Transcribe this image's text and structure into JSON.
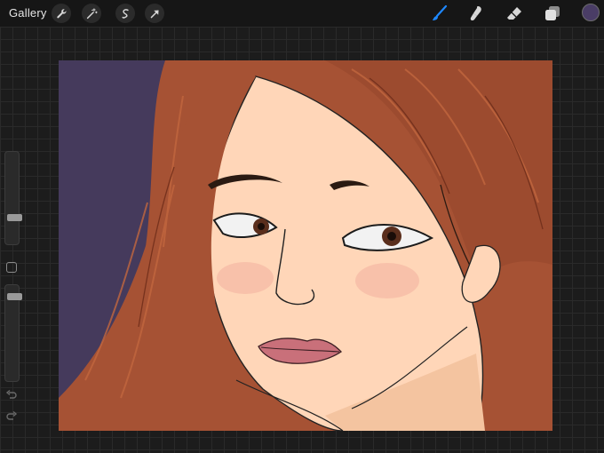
{
  "app": {
    "gallery_label": "Gallery"
  },
  "toolbar_left": [
    {
      "name": "wrench-icon"
    },
    {
      "name": "magic-wand-icon"
    },
    {
      "name": "selection-icon"
    },
    {
      "name": "transform-arrow-icon"
    }
  ],
  "toolbar_right": [
    {
      "name": "brush-icon",
      "active": true
    },
    {
      "name": "smudge-icon",
      "active": false
    },
    {
      "name": "eraser-icon",
      "active": false
    },
    {
      "name": "layers-icon",
      "active": false
    }
  ],
  "colors": {
    "active_tool": "#1e88ff",
    "icon": "#d8d8d8",
    "current_color": "#4a3d66",
    "canvas_background": "#453a5c",
    "hair": "#a65234",
    "skin": "#ffd6b8"
  },
  "sidebar": {
    "brush_size_level": 0.3,
    "opacity_level": 0.95
  }
}
